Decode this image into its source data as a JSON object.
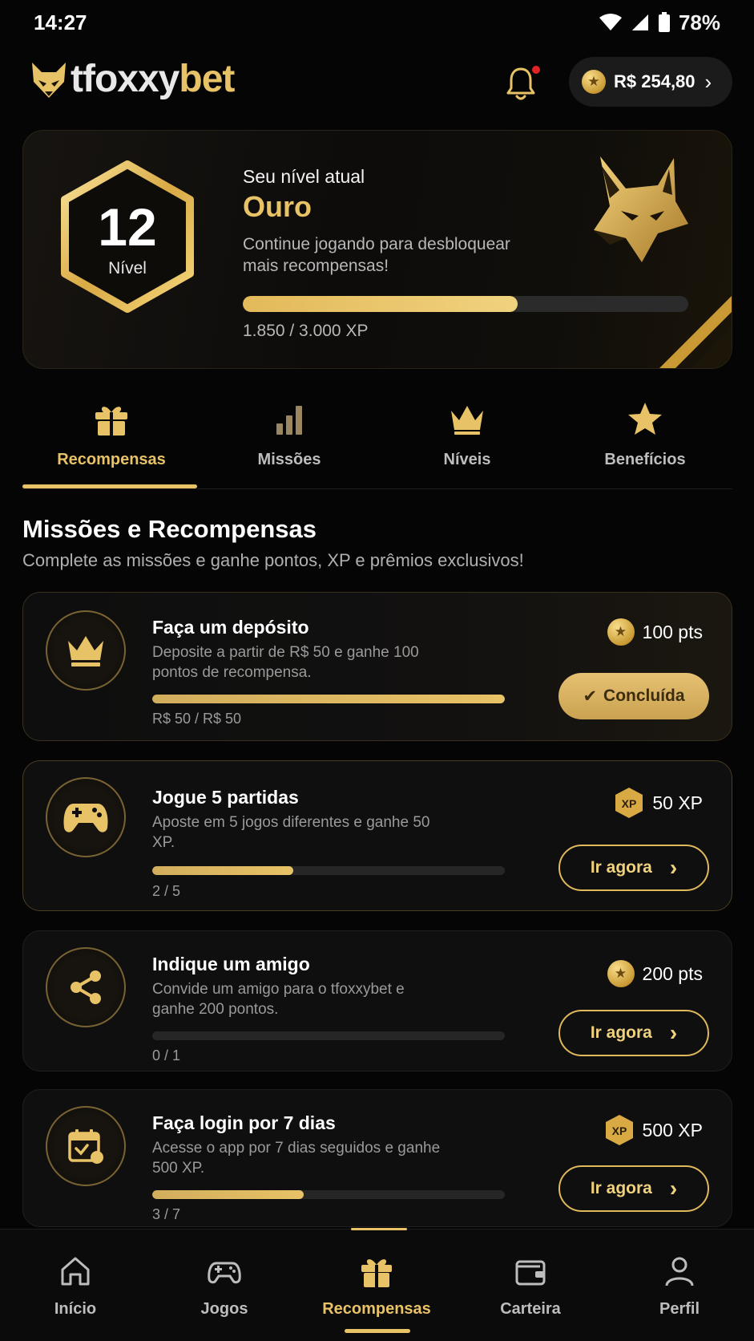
{
  "status_bar": {
    "time": "14:27",
    "battery": "78%"
  },
  "header": {
    "logo_part1": "tfoxxy",
    "logo_part2": "bet",
    "balance": "R$ 254,80"
  },
  "level_card": {
    "title": "Seu nível atual",
    "level_number": "12",
    "level_label": "Nível",
    "tier": "Ouro",
    "description": "Continue jogando para desbloquear mais recompensas!",
    "xp_text": "1.850 / 3.000 XP",
    "xp_progress": 0.617
  },
  "tabs": [
    {
      "label": "Recompensas",
      "icon": "gift-icon",
      "active": true
    },
    {
      "label": "Missões",
      "icon": "bar-chart-icon",
      "active": false
    },
    {
      "label": "Níveis",
      "icon": "crown-icon",
      "active": false
    },
    {
      "label": "Benefícios",
      "icon": "star-icon",
      "active": false
    }
  ],
  "section": {
    "title": "Missões e Recompensas",
    "subtitle": "Complete as missões e ganhe pontos, XP e prêmios exclusivos!"
  },
  "missions": [
    {
      "title": "Faça um depósito",
      "description": "Deposite a partir de R$ 50 e ganhe 100 pontos de recompensa.",
      "progress_text": "R$ 50 / R$ 50",
      "progress": 1.0,
      "reward": "100 pts",
      "reward_type": "points",
      "button": "Concluída",
      "completed": true,
      "icon": "crown-icon"
    },
    {
      "title": "Jogue 5 partidas",
      "description": "Aposte em 5 jogos diferentes e ganhe 50 XP.",
      "progress_text": "2 / 5",
      "progress": 0.4,
      "reward": "50 XP",
      "reward_type": "xp",
      "button": "Ir agora",
      "completed": false,
      "icon": "gamepad-icon"
    },
    {
      "title": "Indique um amigo",
      "description": "Convide um amigo para o tfoxxybet e ganhe 200 pontos.",
      "progress_text": "0 / 1",
      "progress": 0.0,
      "reward": "200 pts",
      "reward_type": "points",
      "button": "Ir agora",
      "completed": false,
      "icon": "share-icon"
    },
    {
      "title": "Faça login por 7 dias",
      "description": "Acesse o app por 7 dias seguidos e ganhe 500 XP.",
      "progress_text": "3 / 7",
      "progress": 0.43,
      "reward": "500 XP",
      "reward_type": "xp",
      "button": "Ir agora",
      "completed": false,
      "icon": "calendar-check-icon"
    }
  ],
  "xp_badge_text": "XP",
  "bottom_nav": [
    {
      "label": "Início",
      "icon": "home-icon",
      "active": false
    },
    {
      "label": "Jogos",
      "icon": "gamepad-icon",
      "active": false
    },
    {
      "label": "Recompensas",
      "icon": "gift-icon",
      "active": true
    },
    {
      "label": "Carteira",
      "icon": "wallet-icon",
      "active": false
    },
    {
      "label": "Perfil",
      "icon": "user-icon",
      "active": false
    }
  ],
  "colors": {
    "accent": "#e8c266",
    "background": "#050505",
    "card": "#0f0f0f"
  }
}
